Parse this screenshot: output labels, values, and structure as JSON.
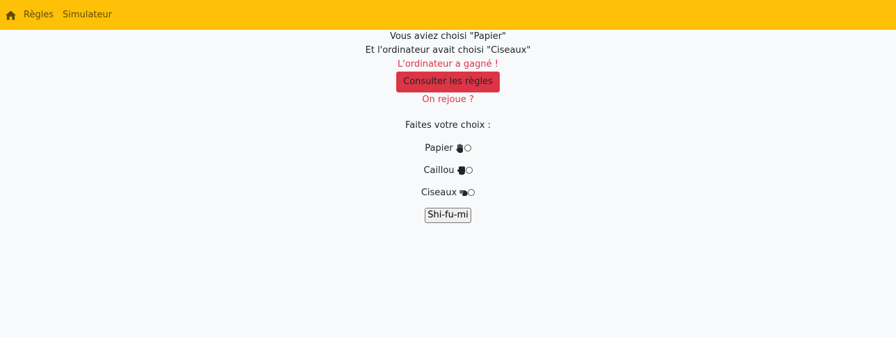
{
  "nav": {
    "home_icon": "home-icon",
    "links": [
      "Règles",
      "Simulateur"
    ]
  },
  "result": {
    "user_choice": "Vous aviez choisi \"Papier\"",
    "computer_choice": "Et l'ordinateur avait choisi \"Ciseaux\"",
    "outcome": "L'ordinateur a gagné !",
    "rules_button": "Consulter les règles",
    "replay": "On rejoue ?"
  },
  "form": {
    "prompt": "Faites votre choix :",
    "options": [
      {
        "label": "Papier",
        "icon": "hand-paper-icon",
        "selected": false
      },
      {
        "label": "Caillou",
        "icon": "hand-rock-icon",
        "selected": false
      },
      {
        "label": "Ciseaux",
        "icon": "hand-scissors-icon",
        "selected": false
      }
    ],
    "submit": "Shi-fu-mi"
  },
  "colors": {
    "navbar": "#ffc107",
    "danger": "#dc3545",
    "background": "#f8f9fa"
  }
}
